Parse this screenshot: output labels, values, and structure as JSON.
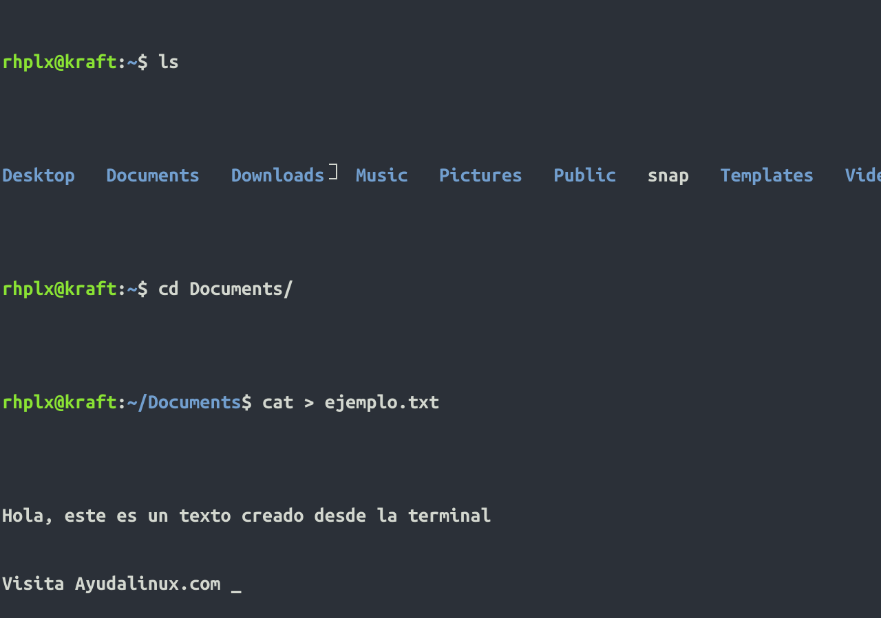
{
  "line0": {
    "user": "rhplx@kraft",
    "sep": ":",
    "path": "~",
    "dollar": "$ ",
    "cmd": "ls"
  },
  "ls_output": {
    "d0": "Desktop",
    "s0": "   ",
    "d1": "Documents",
    "s1": "   ",
    "d2": "Downloads",
    "s2": "   ",
    "d3": "Music",
    "s3": "   ",
    "d4": "Pictures",
    "s4": "   ",
    "d5": "Public",
    "s5": "   ",
    "n0": "snap",
    "s6": "   ",
    "d6": "Templates",
    "s7": "   ",
    "d7": "Videos"
  },
  "line2": {
    "user": "rhplx@kraft",
    "sep": ":",
    "path": "~",
    "dollar": "$ ",
    "cmd": "cd Documents/"
  },
  "line3": {
    "user": "rhplx@kraft",
    "sep": ":",
    "path": "~/Documents",
    "dollar": "$ ",
    "cmd": "cat > ejemplo.txt"
  },
  "input_lines": {
    "l0": "Hola, este es un texto creado desde la terminal",
    "l1": "Visita Ayudalinux.com ",
    "cursor": "_"
  }
}
